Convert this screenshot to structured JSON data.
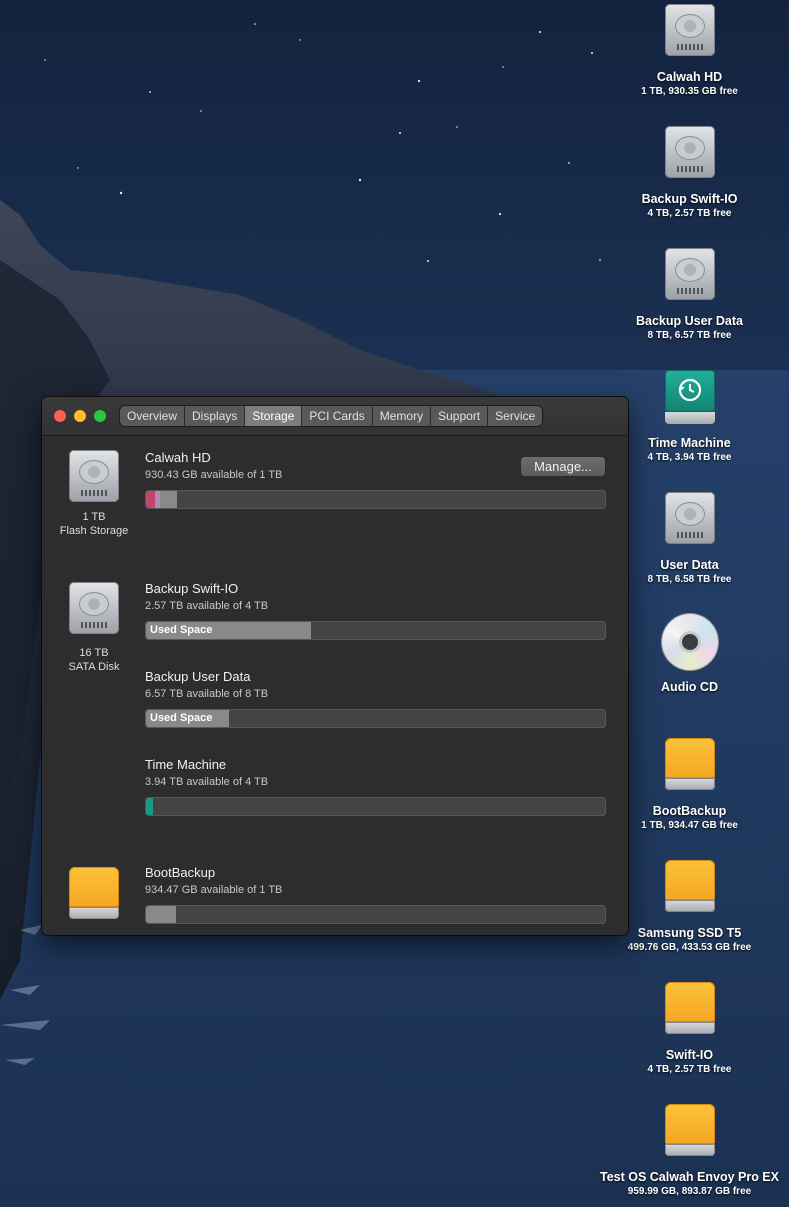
{
  "desktop": {
    "icons": [
      {
        "name": "Calwah HD",
        "sub": "1 TB, 930.35 GB free",
        "kind": "hdd-icon"
      },
      {
        "name": "Backup Swift-IO",
        "sub": "4 TB, 2.57 TB free",
        "kind": "hdd-icon"
      },
      {
        "name": "Backup User Data",
        "sub": "8 TB, 6.57 TB free",
        "kind": "hdd-icon"
      },
      {
        "name": "Time Machine",
        "sub": "4 TB, 3.94 TB free",
        "kind": "time-machine-icon"
      },
      {
        "name": "User Data",
        "sub": "8 TB, 6.58 TB free",
        "kind": "hdd-icon"
      },
      {
        "name": "Audio CD",
        "sub": "",
        "kind": "cd-icon"
      },
      {
        "name": "BootBackup",
        "sub": "1 TB, 934.47 GB free",
        "kind": "external-drive-icon"
      },
      {
        "name": "Samsung SSD T5",
        "sub": "499.76 GB, 433.53 GB free",
        "kind": "external-drive-icon"
      },
      {
        "name": "Swift-IO",
        "sub": "4 TB, 2.57 TB free",
        "kind": "external-drive-icon"
      },
      {
        "name": "Test OS Calwah Envoy Pro EX",
        "sub": "959.99 GB, 893.87 GB free",
        "kind": "external-drive-icon"
      }
    ]
  },
  "window": {
    "tabs": [
      "Overview",
      "Displays",
      "Storage",
      "PCI Cards",
      "Memory",
      "Support",
      "Service"
    ],
    "active_tab": "Storage",
    "manage_label": "Manage...",
    "devices": [
      {
        "size": "1 TB",
        "type": "Flash Storage"
      },
      {
        "size": "16 TB",
        "type": "SATA Disk"
      }
    ],
    "volumes": [
      {
        "name": "Calwah HD",
        "available": "930.43 GB available of 1 TB",
        "used_fraction": 0.07,
        "bar_label": ""
      },
      {
        "name": "Backup Swift-IO",
        "available": "2.57 TB available of 4 TB",
        "used_fraction": 0.36,
        "bar_label": "Used Space"
      },
      {
        "name": "Backup User Data",
        "available": "6.57 TB available of 8 TB",
        "used_fraction": 0.18,
        "bar_label": "Used Space"
      },
      {
        "name": "Time Machine",
        "available": "3.94 TB available of 4 TB",
        "used_fraction": 0.015,
        "bar_label": ""
      },
      {
        "name": "BootBackup",
        "available": "934.47 GB available of 1 TB",
        "used_fraction": 0.065,
        "bar_label": ""
      }
    ]
  },
  "colors": {
    "accent_storage": "#8a898a",
    "system_pink": "#c0466e",
    "time_machine_teal": "#1a9a86"
  }
}
